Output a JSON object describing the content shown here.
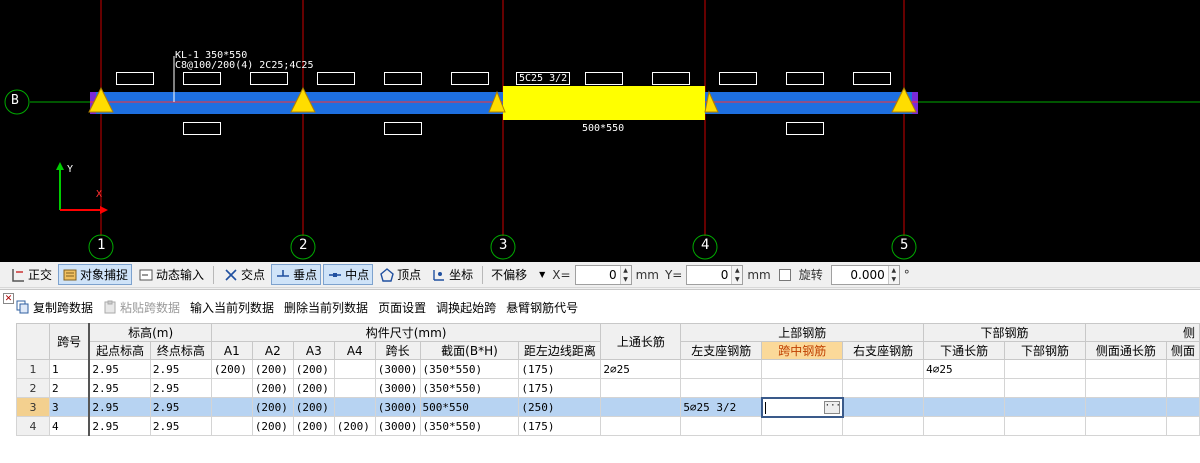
{
  "canvas": {
    "beam_label_line1": "KL-1 350*550",
    "beam_label_line2": "C8@100/200(4) 2C25;4C25",
    "span_label": "5C25 3/2",
    "section_label": "500*550",
    "axis_row": "B",
    "axis_columns": [
      "1",
      "2",
      "3",
      "4",
      "5"
    ],
    "ucs_y": "Y",
    "ucs_x": "X",
    "colors": {
      "beam": "#1e6fe0",
      "highlight": "#ffff00",
      "axis": "#cc0000",
      "support": "#ffdd00",
      "ucs_y": "#00cc00",
      "ucs_x": "#ff0000"
    }
  },
  "snapbar": {
    "ortho": "正交",
    "object_snap": "对象捕捉",
    "dynamic_input": "动态输入",
    "intersection": "交点",
    "perpendicular": "垂点",
    "midpoint": "中点",
    "vertex": "顶点",
    "coordinate": "坐标",
    "offset_mode": "不偏移",
    "x_label": "X=",
    "x_value": "0",
    "y_label": "Y=",
    "y_value": "0",
    "unit": "mm",
    "rotate_label": "旋转",
    "rotate_value": "0.000",
    "degree": "°"
  },
  "grid_toolbar": {
    "copy_span": "复制跨数据",
    "paste_span": "粘贴跨数据",
    "input_current_col": "输入当前列数据",
    "delete_current_col": "删除当前列数据",
    "page_setup": "页面设置",
    "swap_start_span": "调换起始跨",
    "cantilever_code": "悬臂钢筋代号"
  },
  "grid": {
    "group_headers": {
      "span_no": "跨号",
      "elevation": "标高(m)",
      "dimensions": "构件尺寸(mm)",
      "top_through": "上通长筋",
      "top_rebar": "上部钢筋",
      "bottom_rebar": "下部钢筋",
      "side": "侧"
    },
    "sub_headers": {
      "start_elev": "起点标高",
      "end_elev": "终点标高",
      "a1": "A1",
      "a2": "A2",
      "a3": "A3",
      "a4": "A4",
      "span_length": "跨长",
      "section": "截面(B*H)",
      "dist_left": "距左边线距离",
      "left_support": "左支座钢筋",
      "mid_span": "跨中钢筋",
      "right_support": "右支座钢筋",
      "bottom_through": "下通长筋",
      "bottom_bar": "下部钢筋",
      "side_through": "侧面通长筋",
      "side_more": "侧面"
    },
    "rows": [
      {
        "idx": "1",
        "span": "1",
        "start": "2.95",
        "end": "2.95",
        "a1": "(200)",
        "a2": "(200)",
        "a3": "(200)",
        "a4": "",
        "length": "(3000)",
        "section": "(350*550)",
        "dist": "(175)",
        "top_through": "2⌀25",
        "left_support": "",
        "mid": "",
        "right_support": "",
        "bottom_through": "4⌀25",
        "bottom_bar": "",
        "side_through": "",
        "side_more": ""
      },
      {
        "idx": "2",
        "span": "2",
        "start": "2.95",
        "end": "2.95",
        "a1": "",
        "a2": "(200)",
        "a3": "(200)",
        "a4": "",
        "length": "(3000)",
        "section": "(350*550)",
        "dist": "(175)",
        "top_through": "",
        "left_support": "",
        "mid": "",
        "right_support": "",
        "bottom_through": "",
        "bottom_bar": "",
        "side_through": "",
        "side_more": ""
      },
      {
        "idx": "3",
        "span": "3",
        "start": "2.95",
        "end": "2.95",
        "a1": "",
        "a2": "(200)",
        "a3": "(200)",
        "a4": "",
        "length": "(3000)",
        "section": "500*550",
        "dist": "(250)",
        "top_through": "",
        "left_support": "5⌀25 3/2",
        "mid": "",
        "right_support": "",
        "bottom_through": "",
        "bottom_bar": "",
        "side_through": "",
        "side_more": ""
      },
      {
        "idx": "4",
        "span": "4",
        "start": "2.95",
        "end": "2.95",
        "a1": "",
        "a2": "(200)",
        "a3": "(200)",
        "a4": "(200)",
        "length": "(3000)",
        "section": "(350*550)",
        "dist": "(175)",
        "top_through": "",
        "left_support": "",
        "mid": "",
        "right_support": "",
        "bottom_through": "",
        "bottom_bar": "",
        "side_through": "",
        "side_more": ""
      }
    ]
  }
}
